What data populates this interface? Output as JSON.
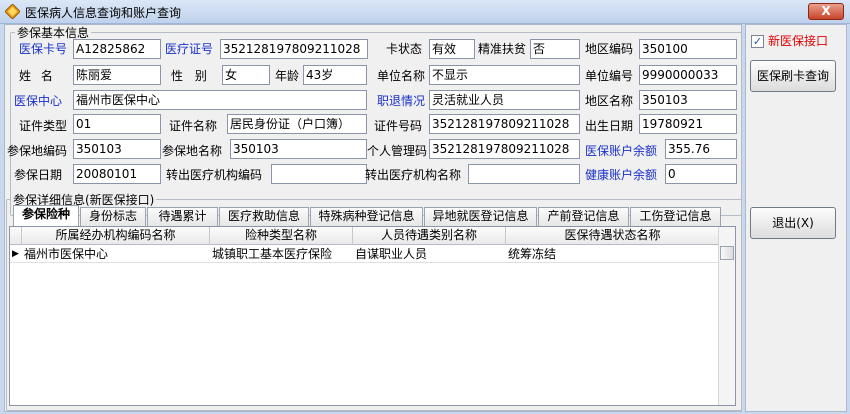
{
  "window": {
    "title": "医保病人信息查询和账户查询",
    "close": "X"
  },
  "basic": {
    "legend": "参保基本信息",
    "card_no_label": "医保卡号",
    "card_no": "A12825862",
    "medical_cert_label": "医疗证号",
    "medical_cert": "352128197809211028",
    "card_status_label": "卡状态",
    "card_status": "有效",
    "poverty_label": "精准扶贫",
    "poverty": "否",
    "area_code_label": "地区编码",
    "area_code": "350100",
    "name_label": "姓 名",
    "name": "陈丽爱",
    "gender_label": "性 别",
    "gender": "女",
    "age_label": "年龄",
    "age": "43岁",
    "unit_name_label": "单位名称",
    "unit_name": "不显示",
    "unit_no_label": "单位编号",
    "unit_no": "9990000033",
    "center_label": "医保中心",
    "center": "福州市医保中心",
    "retire_label": "职退情况",
    "retire": "灵活就业人员",
    "area_name_label": "地区名称",
    "area_name": "350103",
    "id_type_label": "证件类型",
    "id_type": "01",
    "id_name_label": "证件名称",
    "id_name": "居民身份证（户口簿）",
    "id_no_label": "证件号码",
    "id_no": "352128197809211028",
    "birth_label": "出生日期",
    "birth": "19780921",
    "ins_area_code_label": "参保地编码",
    "ins_area_code": "350103",
    "ins_area_name_label": "参保地名称",
    "ins_area_name": "350103",
    "personal_no_label": "个人管理码",
    "personal_no": "352128197809211028",
    "balance_label": "医保账户余额",
    "balance": "355.76",
    "ins_date_label": "参保日期",
    "ins_date": "20080101",
    "out_code_label": "转出医疗机构编码",
    "out_code": "",
    "out_name_label": "转出医疗机构名称",
    "out_name": "",
    "health_balance_label": "健康账户余额",
    "health_balance": "0"
  },
  "detail": {
    "legend": "参保详细信息(新医保接口)",
    "tabs": [
      "参保险种",
      "身份标志",
      "待遇累计",
      "医疗救助信息",
      "特殊病种登记信息",
      "异地就医登记信息",
      "产前登记信息",
      "工伤登记信息"
    ],
    "columns": [
      "所属经办机构编码名称",
      "险种类型名称",
      "人员待遇类别名称",
      "医保待遇状态名称"
    ],
    "rows": [
      [
        "福州市医保中心",
        "城镇职工基本医疗保险",
        "自谋职业人员",
        "统筹冻结"
      ]
    ],
    "row_marker": "▶"
  },
  "side": {
    "checkbox_label": "新医保接口",
    "checkbox_mark": "✓",
    "scan_button": "医保刷卡查询",
    "exit_button": "退出(X)"
  },
  "colors": {
    "blue_label": "#1830c8",
    "red_label": "#e00000"
  }
}
